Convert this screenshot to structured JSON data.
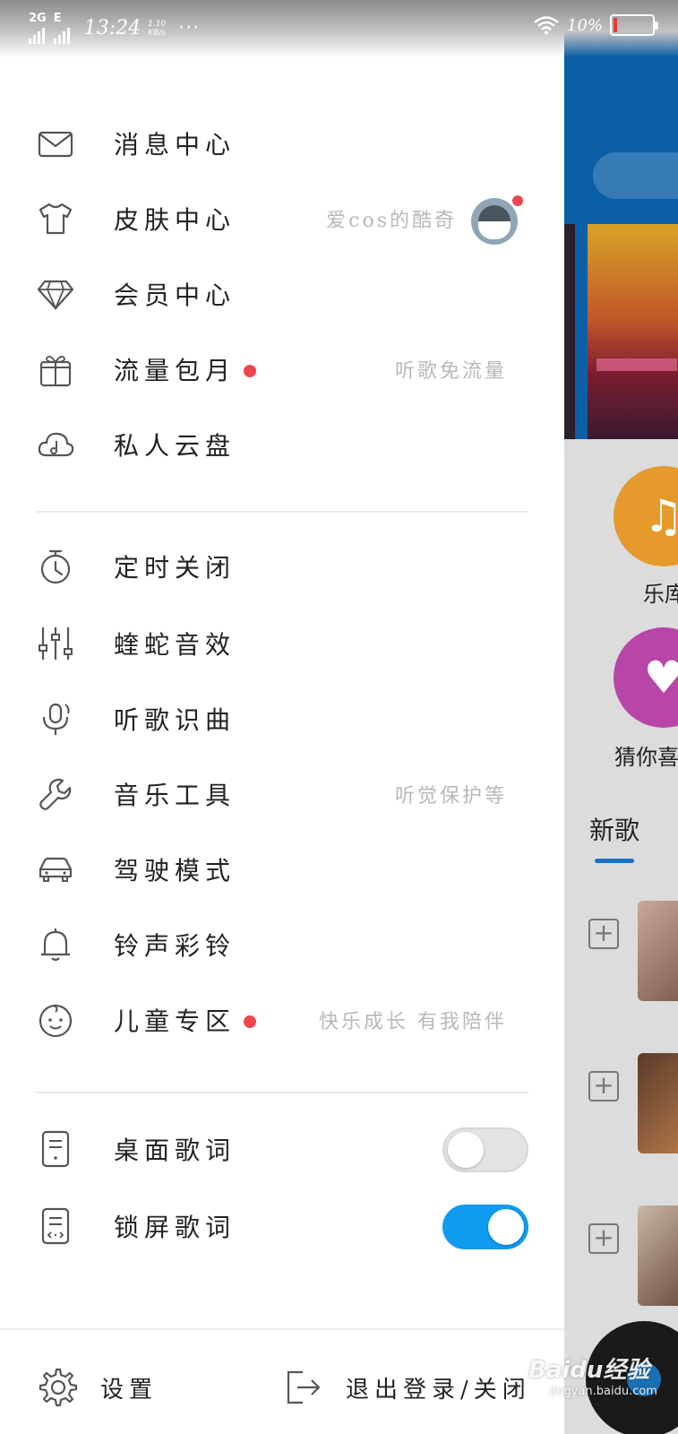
{
  "status_bar": {
    "network": "2G",
    "network2": "E",
    "time": "13:24",
    "speed_value": "1.10",
    "speed_unit": "KB/s",
    "more": "···",
    "battery_percent": "10%"
  },
  "menu_group1": [
    {
      "label": "消息中心",
      "icon": "mail-icon"
    },
    {
      "label": "皮肤中心",
      "icon": "tshirt-icon",
      "sub": "爱cos的酷奇",
      "has_avatar": true
    },
    {
      "label": "会员中心",
      "icon": "diamond-icon"
    },
    {
      "label": "流量包月",
      "icon": "gift-icon",
      "sub": "听歌免流量",
      "dot": true
    },
    {
      "label": "私人云盘",
      "icon": "cloud-music-icon"
    }
  ],
  "menu_group2": [
    {
      "label": "定时关闭",
      "icon": "timer-icon"
    },
    {
      "label": "蝰蛇音效",
      "icon": "equalizer-icon"
    },
    {
      "label": "听歌识曲",
      "icon": "mic-recognize-icon"
    },
    {
      "label": "音乐工具",
      "icon": "wrench-icon",
      "sub": "听觉保护等"
    },
    {
      "label": "驾驶模式",
      "icon": "car-icon"
    },
    {
      "label": "铃声彩铃",
      "icon": "bell-icon"
    },
    {
      "label": "儿童专区",
      "icon": "baby-icon",
      "sub": "快乐成长 有我陪伴",
      "dot": true
    }
  ],
  "menu_group3": [
    {
      "label": "桌面歌词",
      "icon": "desktop-lyrics-icon",
      "toggle": false
    },
    {
      "label": "锁屏歌词",
      "icon": "lockscreen-lyrics-icon",
      "toggle": true
    }
  ],
  "bottom": {
    "settings_label": "设置",
    "logout_label": "退出登录/关闭"
  },
  "background_app": {
    "music_label": "乐库",
    "radio_label": "猜你喜",
    "new_songs_tab": "新歌",
    "add_symbol": "+"
  },
  "watermark": {
    "main": "Baidu经验",
    "sub": "jingyan.baidu.com"
  },
  "colors": {
    "accent": "#0e9bf0",
    "badge": "#f0454f",
    "text": "#222222",
    "subtext": "#b8b8b8",
    "bg_header": "#0b5fa7"
  }
}
